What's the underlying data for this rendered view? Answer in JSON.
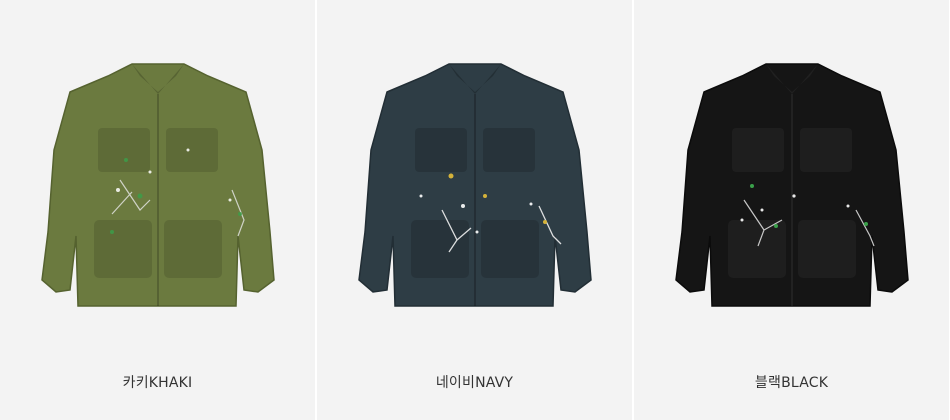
{
  "products": [
    {
      "label": "카키KHAKI",
      "color": "#6b7a3f",
      "shade": "#55622f"
    },
    {
      "label": "네이비NAVY",
      "color": "#2e3d45",
      "shade": "#222e35"
    },
    {
      "label": "블랙BLACK",
      "color": "#151515",
      "shade": "#0b0b0b"
    }
  ]
}
